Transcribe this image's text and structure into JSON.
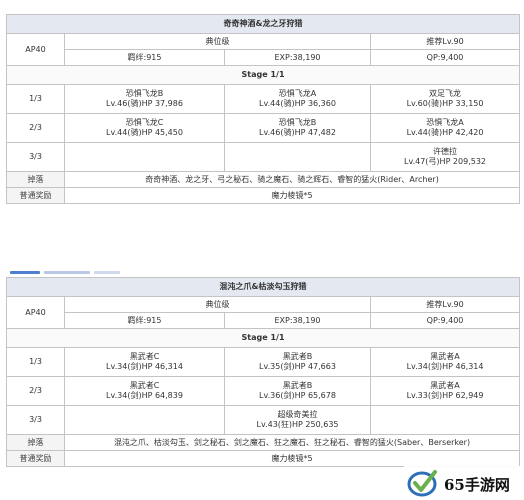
{
  "quests": [
    {
      "title": "奇奇神酒&龙之牙狩猎",
      "ap": "AP40",
      "difficulty": "典位级",
      "recommend": "推荐Lv.90",
      "bond": "羁绊:915",
      "exp": "EXP:38,190",
      "qp": "QP:9,400",
      "stage_header": "Stage 1/1",
      "waves": [
        {
          "label": "1/3",
          "enemies": [
            {
              "name": "恐惧飞龙B",
              "stats": "Lv.46(骑)HP 37,986"
            },
            {
              "name": "恐惧飞龙A",
              "stats": "Lv.44(骑)HP 36,360"
            },
            {
              "name": "双足飞龙",
              "stats": "Lv.60(骑)HP 33,150"
            }
          ]
        },
        {
          "label": "2/3",
          "enemies": [
            {
              "name": "恐惧飞龙C",
              "stats": "Lv.44(骑)HP 45,450"
            },
            {
              "name": "恐惧飞龙B",
              "stats": "Lv.46(骑)HP 47,482"
            },
            {
              "name": "恐惧飞龙A",
              "stats": "Lv.44(骑)HP 42,420"
            }
          ]
        },
        {
          "label": "3/3",
          "enemies": [
            {
              "name": "",
              "stats": ""
            },
            {
              "name": "",
              "stats": ""
            },
            {
              "name": "许德拉",
              "stats": "Lv.47(弓)HP 209,532"
            }
          ]
        }
      ],
      "drops_label": "掉落",
      "drops": "奇奇神酒、龙之牙、弓之秘石、骑之魔石、骑之辉石、睿智的猛火(Rider、Archer)",
      "reward_label": "普通奖励",
      "reward": "魔力棱镜*5"
    },
    {
      "title": "混沌之爪&枯淡勾玉狩猎",
      "ap": "AP40",
      "difficulty": "典位级",
      "recommend": "推荐Lv.90",
      "bond": "羁绊:915",
      "exp": "EXP:38,190",
      "qp": "QP:9,400",
      "stage_header": "Stage 1/1",
      "waves": [
        {
          "label": "1/3",
          "enemies": [
            {
              "name": "黑武者C",
              "stats": "Lv.34(剑)HP 46,314"
            },
            {
              "name": "黑武者B",
              "stats": "Lv.35(剑)HP 47,663"
            },
            {
              "name": "黑武者A",
              "stats": "Lv.34(剑)HP 46,314"
            }
          ]
        },
        {
          "label": "2/3",
          "enemies": [
            {
              "name": "黑武者C",
              "stats": "Lv.34(剑)HP 64,839"
            },
            {
              "name": "黑武者B",
              "stats": "Lv.36(剑)HP 65,678"
            },
            {
              "name": "黑武者A",
              "stats": "Lv.33(剑)HP 62,949"
            }
          ]
        },
        {
          "label": "3/3",
          "enemies": [
            {
              "name": "",
              "stats": ""
            },
            {
              "name": "超级奇美拉",
              "stats": "Lv.43(狂)HP 250,635"
            },
            {
              "name": "",
              "stats": ""
            }
          ]
        }
      ],
      "drops_label": "掉落",
      "drops": "混沌之爪、枯淡勾玉、剑之秘石、剑之魔石、狂之魔石、狂之秘石、睿智的猛火(Saber、Berserker)",
      "reward_label": "普通奖励",
      "reward": "魔力棱镜*5"
    }
  ],
  "watermark": {
    "text": "65手游网",
    "icon": "checkmark-logo-icon",
    "colors": {
      "ring": "#2c6fb7",
      "check": "#6ab04c"
    }
  }
}
